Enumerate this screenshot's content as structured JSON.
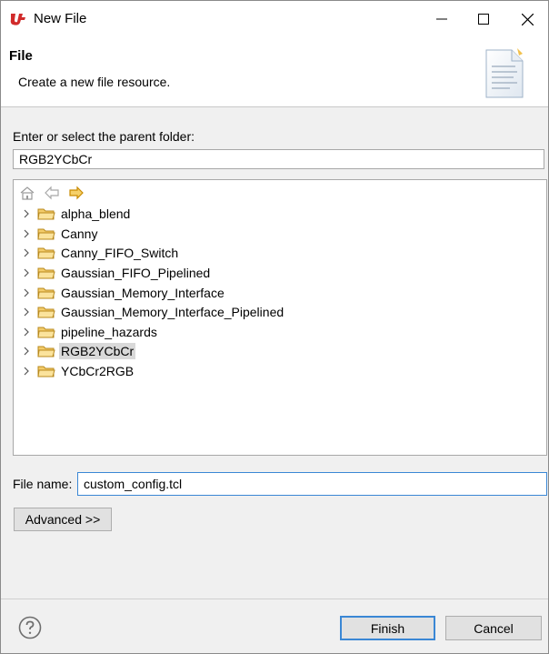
{
  "window": {
    "title": "New File",
    "controls": {
      "minimize": "minimize-icon",
      "maximize": "maximize-icon",
      "close": "close-icon"
    }
  },
  "header": {
    "title": "File",
    "description": "Create a new file resource."
  },
  "parent_folder": {
    "label": "Enter or select the parent folder:",
    "value": "RGB2YCbCr"
  },
  "tree": {
    "nav_icons": [
      "home-icon",
      "back-icon",
      "forward-icon"
    ],
    "items": [
      {
        "label": "alpha_blend",
        "selected": false
      },
      {
        "label": "Canny",
        "selected": false
      },
      {
        "label": "Canny_FIFO_Switch",
        "selected": false
      },
      {
        "label": "Gaussian_FIFO_Pipelined",
        "selected": false
      },
      {
        "label": "Gaussian_Memory_Interface",
        "selected": false
      },
      {
        "label": "Gaussian_Memory_Interface_Pipelined",
        "selected": false
      },
      {
        "label": "pipeline_hazards",
        "selected": false
      },
      {
        "label": "RGB2YCbCr",
        "selected": true
      },
      {
        "label": "YCbCr2RGB",
        "selected": false
      }
    ]
  },
  "file_name": {
    "label": "File name:",
    "value": "custom_config.tcl"
  },
  "buttons": {
    "advanced": "Advanced >>",
    "finish": "Finish",
    "cancel": "Cancel"
  },
  "colors": {
    "accent": "#3a87d5",
    "selection": "#d9d9d9",
    "folder": "#e8b84a",
    "logo": "#d12b2b"
  }
}
